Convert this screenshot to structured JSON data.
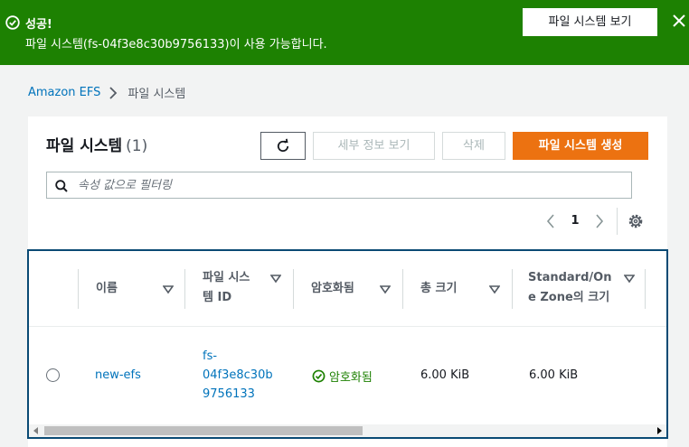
{
  "flash": {
    "title": "성공!",
    "message": "파일 시스템(fs-04f3e8c30b9756133)이 사용 가능합니다.",
    "view_button": "파일 시스템 보기",
    "background": "#1d8102"
  },
  "breadcrumb": {
    "root": "Amazon EFS",
    "current": "파일 시스템"
  },
  "panel": {
    "title": "파일 시스템",
    "count": "(1)",
    "buttons": {
      "details": "세부 정보 보기",
      "delete": "삭제",
      "create": "파일 시스템 생성"
    },
    "search_placeholder": "속성 값으로 필터링",
    "page_number": "1"
  },
  "table": {
    "columns": [
      {
        "line1": "이름",
        "line2": ""
      },
      {
        "line1": "파일 시스",
        "line2": "템 ID"
      },
      {
        "line1": "암호화됨",
        "line2": ""
      },
      {
        "line1": "총 크기",
        "line2": ""
      },
      {
        "line1": "Standard/On",
        "line2": "e Zone의 크기"
      }
    ],
    "rows": [
      {
        "name": "new-efs",
        "id_lines": [
          "fs-",
          "04f3e8c30b",
          "9756133"
        ],
        "encrypted": "암호화됨",
        "total_size": "6.00 KiB",
        "standard_size": "6.00 KiB"
      }
    ]
  },
  "colors": {
    "link": "#0073bb",
    "primary": "#ec7211",
    "success": "#1d8102"
  }
}
